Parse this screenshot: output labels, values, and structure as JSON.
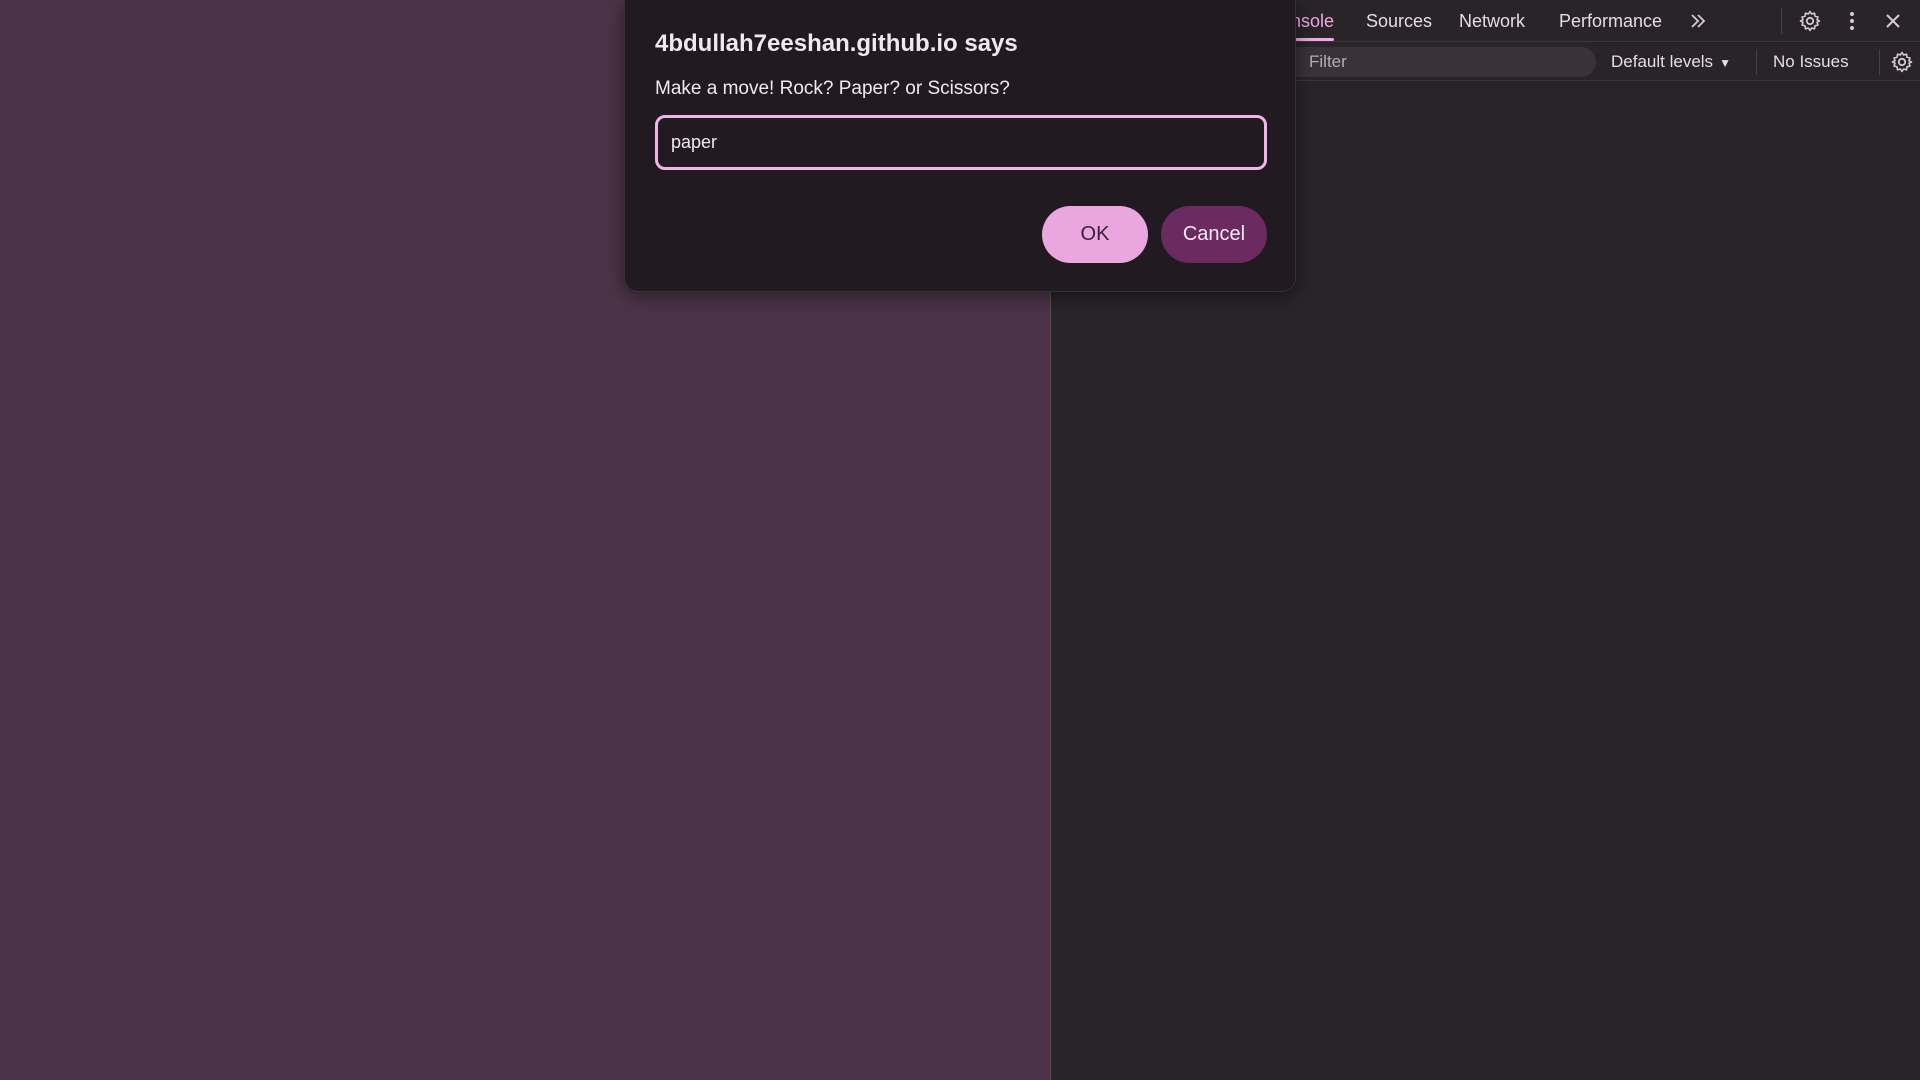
{
  "devtools": {
    "tabs": [
      {
        "label": "nsole",
        "active": true
      },
      {
        "label": "Sources",
        "active": false
      },
      {
        "label": "Network",
        "active": false
      },
      {
        "label": "Performance",
        "active": false
      }
    ],
    "more_tabs_glyph": "»",
    "filter_placeholder": "Filter",
    "levels_label": "Default levels",
    "issues_label": "No Issues",
    "icons": [
      "chevron-double-right-icon",
      "gear-icon",
      "kebab-menu-icon",
      "close-icon",
      "console-settings-gear-icon"
    ]
  },
  "dialog": {
    "title": "4bdullah7eeshan.github.io says",
    "message": "Make a move! Rock? Paper? or Scissors?",
    "input_value": "paper",
    "ok_label": "OK",
    "cancel_label": "Cancel"
  },
  "colors": {
    "page_background": "#4b3447",
    "devtools_background": "#282428",
    "dialog_background": "#211a20",
    "accent": "#f0a8e0",
    "ok_button": "#eaa6de",
    "cancel_button": "#6b2b60"
  }
}
